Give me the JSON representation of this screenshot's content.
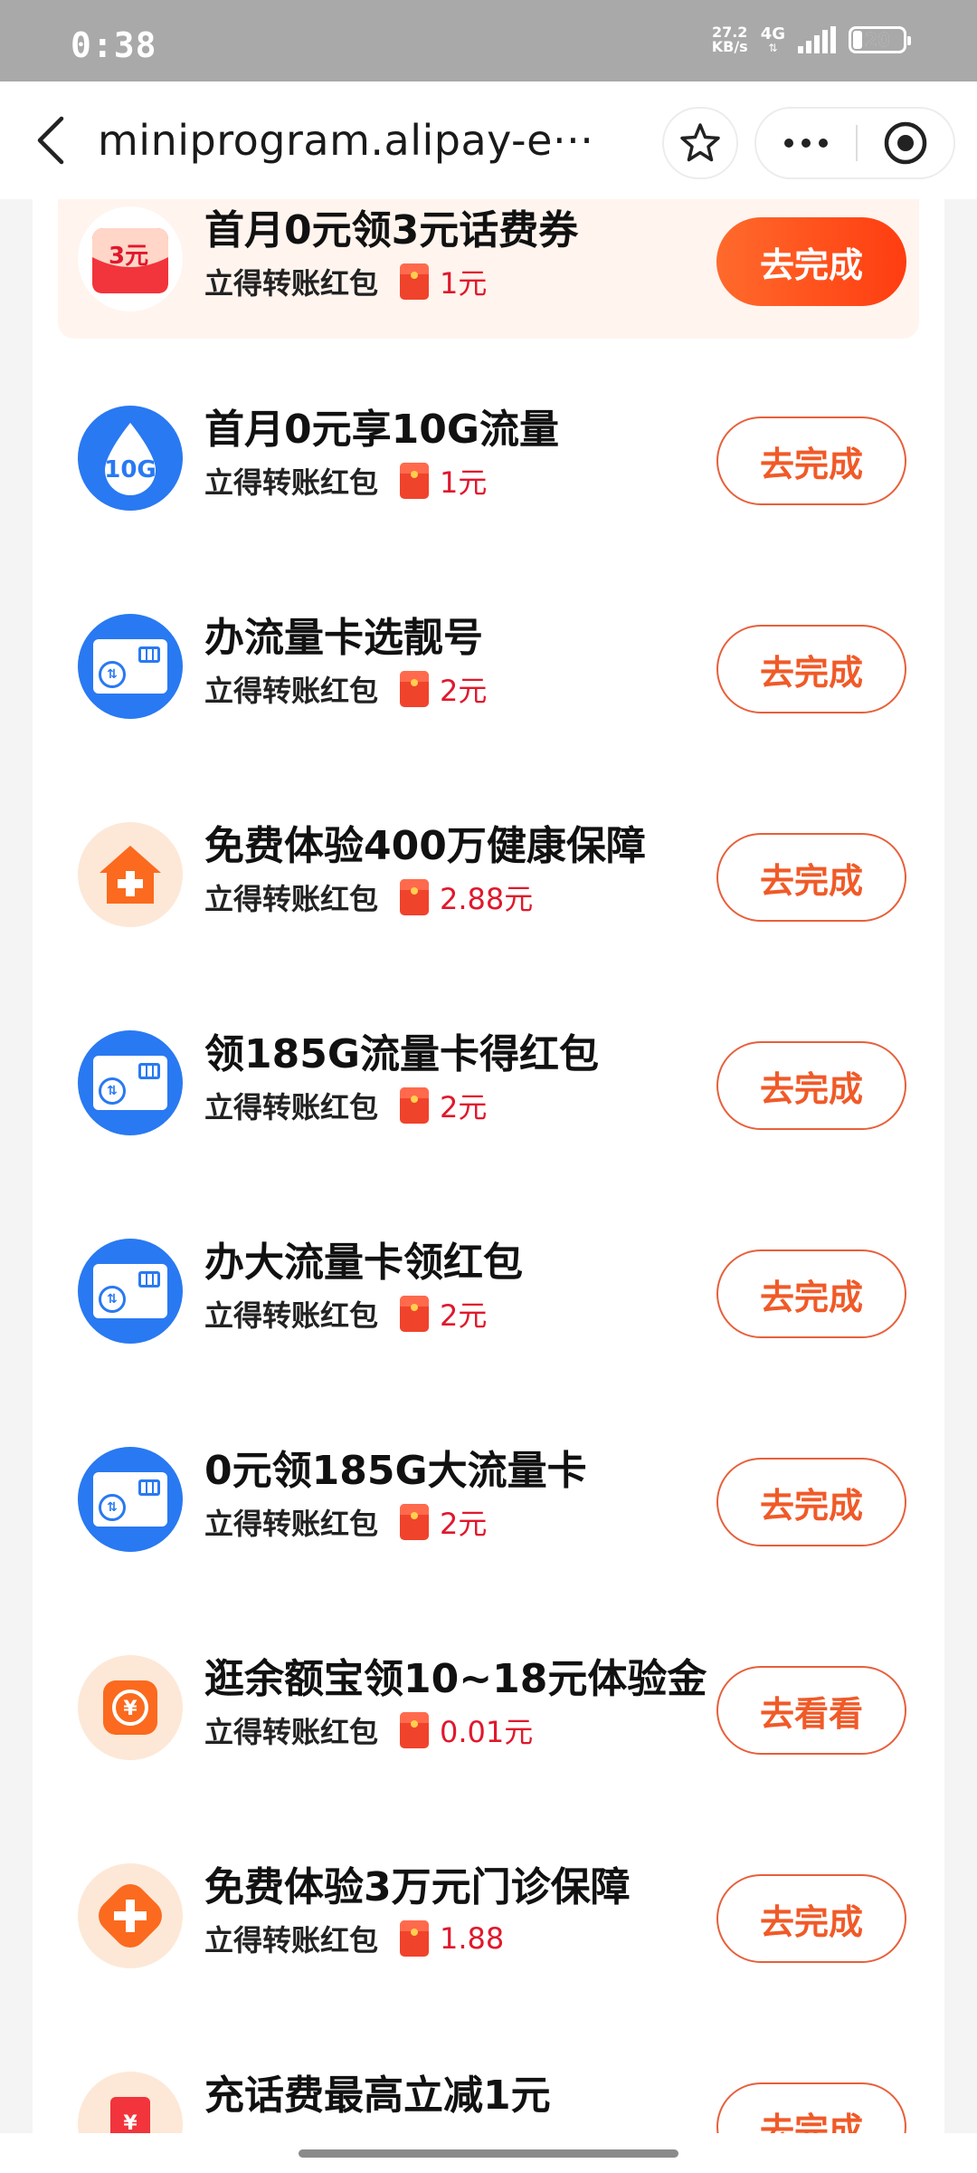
{
  "status_bar": {
    "time": "0:38",
    "net_speed_value": "27.2",
    "net_speed_unit": "KB/s",
    "network": "4G",
    "battery": "20"
  },
  "nav": {
    "url": "miniprogram.alipay-e···"
  },
  "tasks": [
    {
      "title": "首月0元领3元话费券",
      "subtitle": "立得转账红包",
      "amount": "1元",
      "button": "去完成",
      "icon": "coupon-3yuan-icon",
      "icon_badge": "3元"
    },
    {
      "title": "首月0元享10G流量",
      "subtitle": "立得转账红包",
      "amount": "1元",
      "button": "去完成",
      "icon": "data-drop-icon",
      "icon_badge": "10G"
    },
    {
      "title": "办流量卡选靓号",
      "subtitle": "立得转账红包",
      "amount": "2元",
      "button": "去完成",
      "icon": "sim-card-icon"
    },
    {
      "title": "免费体验400万健康保障",
      "subtitle": "立得转账红包",
      "amount": "2.88元",
      "button": "去完成",
      "icon": "health-house-icon"
    },
    {
      "title": "领185G流量卡得红包",
      "subtitle": "立得转账红包",
      "amount": "2元",
      "button": "去完成",
      "icon": "sim-card-icon"
    },
    {
      "title": "办大流量卡领红包",
      "subtitle": "立得转账红包",
      "amount": "2元",
      "button": "去完成",
      "icon": "sim-card-icon"
    },
    {
      "title": "0元领185G大流量卡",
      "subtitle": "立得转账红包",
      "amount": "2元",
      "button": "去完成",
      "icon": "sim-card-icon"
    },
    {
      "title": "逛余额宝领10~18元体验金",
      "subtitle": "立得转账红包",
      "amount": "0.01元",
      "button": "去看看",
      "icon": "yuebao-yen-icon"
    },
    {
      "title": "免费体验3万元门诊保障",
      "subtitle": "立得转账红包",
      "amount": "1.88",
      "button": "去完成",
      "icon": "medical-plus-icon"
    },
    {
      "title": "充话费最高立减1元",
      "subtitle": "",
      "amount": "",
      "button": "去完成",
      "icon": "phone-bill-icon"
    }
  ],
  "colors": {
    "accent": "#f05a28",
    "amount": "#e0182c",
    "blue": "#2979f2",
    "orange_soft": "#fde8d7"
  }
}
